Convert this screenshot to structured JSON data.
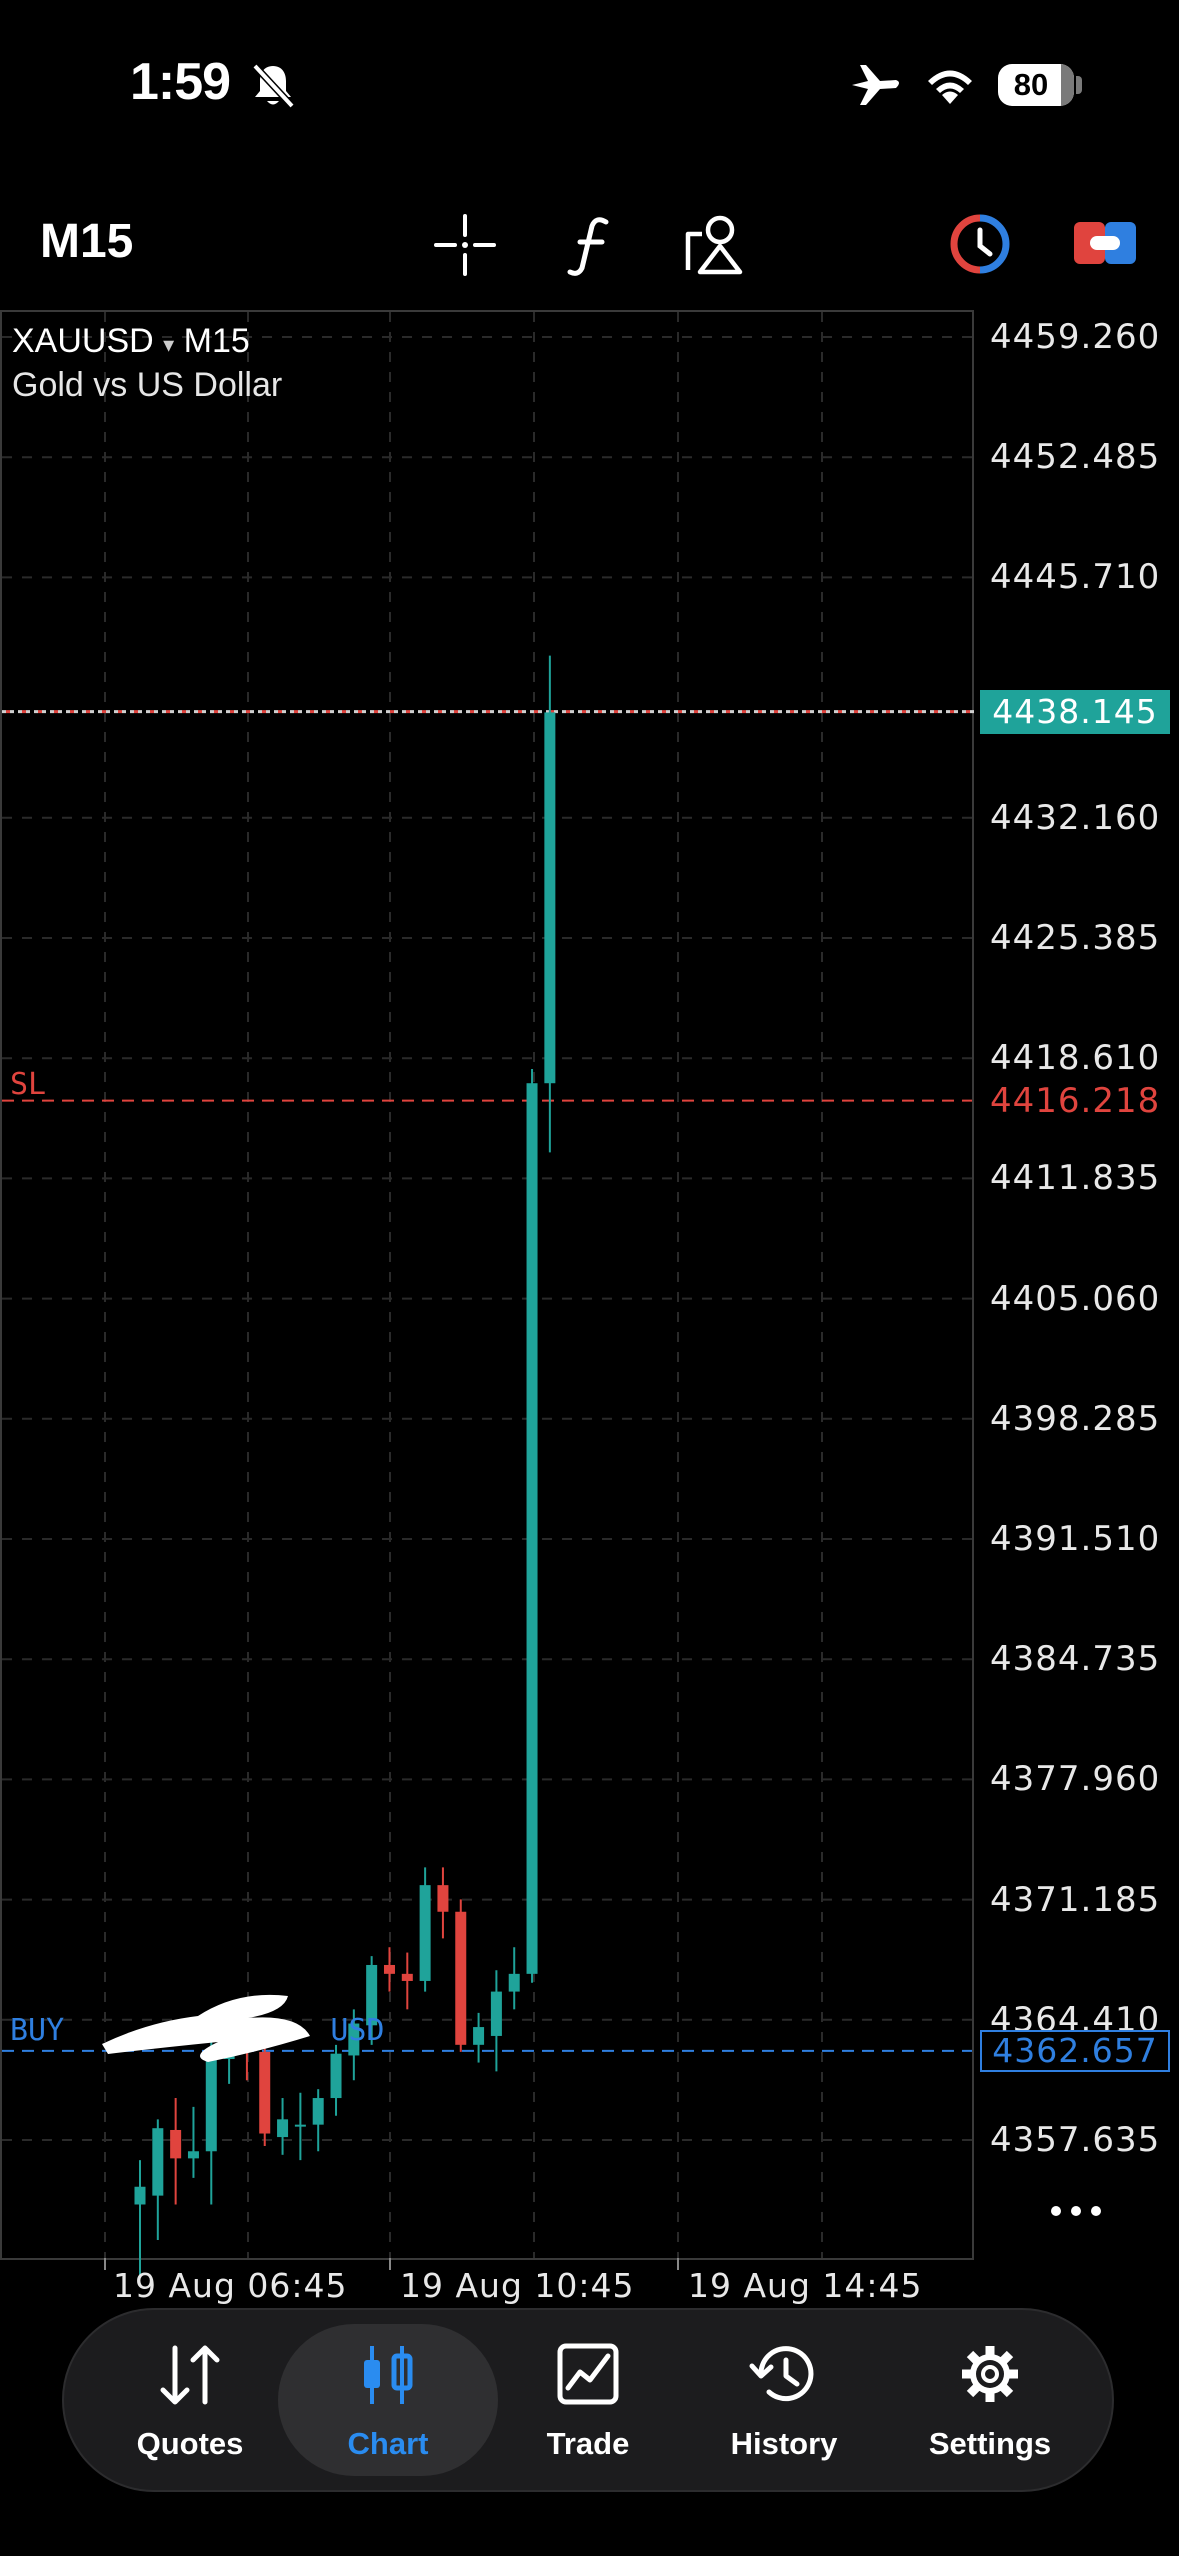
{
  "status": {
    "time": "1:59",
    "battery": "80"
  },
  "toolbar": {
    "timeframe": "M15"
  },
  "chart": {
    "symbol": "XAUUSD",
    "symbol_arrow": "▾",
    "period": "M15",
    "description": "Gold vs US Dollar",
    "current_price": "4438.145",
    "sl_label": "SL",
    "sl_price": "4416.218",
    "buy_label_prefix": "BUY",
    "buy_label_suffix": "USD",
    "buy_price": "4362.657",
    "price_ticks": [
      "4459.260",
      "4452.485",
      "4445.710",
      "4432.160",
      "4425.385",
      "4418.610",
      "4411.835",
      "4405.060",
      "4398.285",
      "4391.510",
      "4384.735",
      "4377.960",
      "4371.185",
      "4364.410",
      "4357.635"
    ],
    "time_ticks": [
      "19 Aug 06:45",
      "19 Aug 10:45",
      "19 Aug 14:45"
    ],
    "colors": {
      "bull": "#1fa39a",
      "bear": "#e0443e",
      "buy": "#2f7fe0",
      "grid": "#2a2a2a"
    }
  },
  "chart_data": {
    "type": "candlestick",
    "symbol": "XAUUSD",
    "ylim": [
      4355.0,
      4461.0
    ],
    "candles": [
      {
        "o": 4354.0,
        "h": 4356.5,
        "l": 4350.0,
        "c": 4355.0
      },
      {
        "o": 4354.5,
        "h": 4358.8,
        "l": 4352.0,
        "c": 4358.3
      },
      {
        "o": 4358.2,
        "h": 4360.0,
        "l": 4354.0,
        "c": 4356.6
      },
      {
        "o": 4356.6,
        "h": 4359.5,
        "l": 4355.5,
        "c": 4357.0
      },
      {
        "o": 4357.0,
        "h": 4363.5,
        "l": 4354.0,
        "c": 4362.3
      },
      {
        "o": 4362.2,
        "h": 4364.7,
        "l": 4360.8,
        "c": 4363.0
      },
      {
        "o": 4362.8,
        "h": 4364.0,
        "l": 4361.0,
        "c": 4362.6
      },
      {
        "o": 4362.6,
        "h": 4364.0,
        "l": 4357.3,
        "c": 4358.0
      },
      {
        "o": 4357.8,
        "h": 4360.0,
        "l": 4356.8,
        "c": 4358.8
      },
      {
        "o": 4358.4,
        "h": 4360.3,
        "l": 4356.5,
        "c": 4358.5
      },
      {
        "o": 4358.5,
        "h": 4360.5,
        "l": 4357.0,
        "c": 4360.0
      },
      {
        "o": 4360.0,
        "h": 4363.0,
        "l": 4359.0,
        "c": 4362.5
      },
      {
        "o": 4362.4,
        "h": 4365.0,
        "l": 4361.0,
        "c": 4364.2
      },
      {
        "o": 4364.1,
        "h": 4368.0,
        "l": 4363.0,
        "c": 4367.5
      },
      {
        "o": 4367.5,
        "h": 4368.5,
        "l": 4366.0,
        "c": 4367.0
      },
      {
        "o": 4367.0,
        "h": 4368.2,
        "l": 4365.0,
        "c": 4366.6
      },
      {
        "o": 4366.6,
        "h": 4373.0,
        "l": 4366.0,
        "c": 4372.0
      },
      {
        "o": 4372.0,
        "h": 4373.0,
        "l": 4369.0,
        "c": 4370.5
      },
      {
        "o": 4370.5,
        "h": 4371.2,
        "l": 4362.6,
        "c": 4363.0
      },
      {
        "o": 4363.0,
        "h": 4364.8,
        "l": 4362.0,
        "c": 4364.0
      },
      {
        "o": 4363.5,
        "h": 4367.2,
        "l": 4361.5,
        "c": 4366.0
      },
      {
        "o": 4366.0,
        "h": 4368.5,
        "l": 4365.0,
        "c": 4367.0
      },
      {
        "o": 4367.0,
        "h": 4418.0,
        "l": 4366.5,
        "c": 4417.2
      },
      {
        "o": 4417.2,
        "h": 4441.3,
        "l": 4413.3,
        "c": 4438.1
      }
    ],
    "sl_level": 4416.218,
    "buy_level": 4362.657,
    "current": 4438.145
  },
  "nav": {
    "items": [
      {
        "label": "Quotes"
      },
      {
        "label": "Chart"
      },
      {
        "label": "Trade"
      },
      {
        "label": "History"
      },
      {
        "label": "Settings"
      }
    ]
  }
}
